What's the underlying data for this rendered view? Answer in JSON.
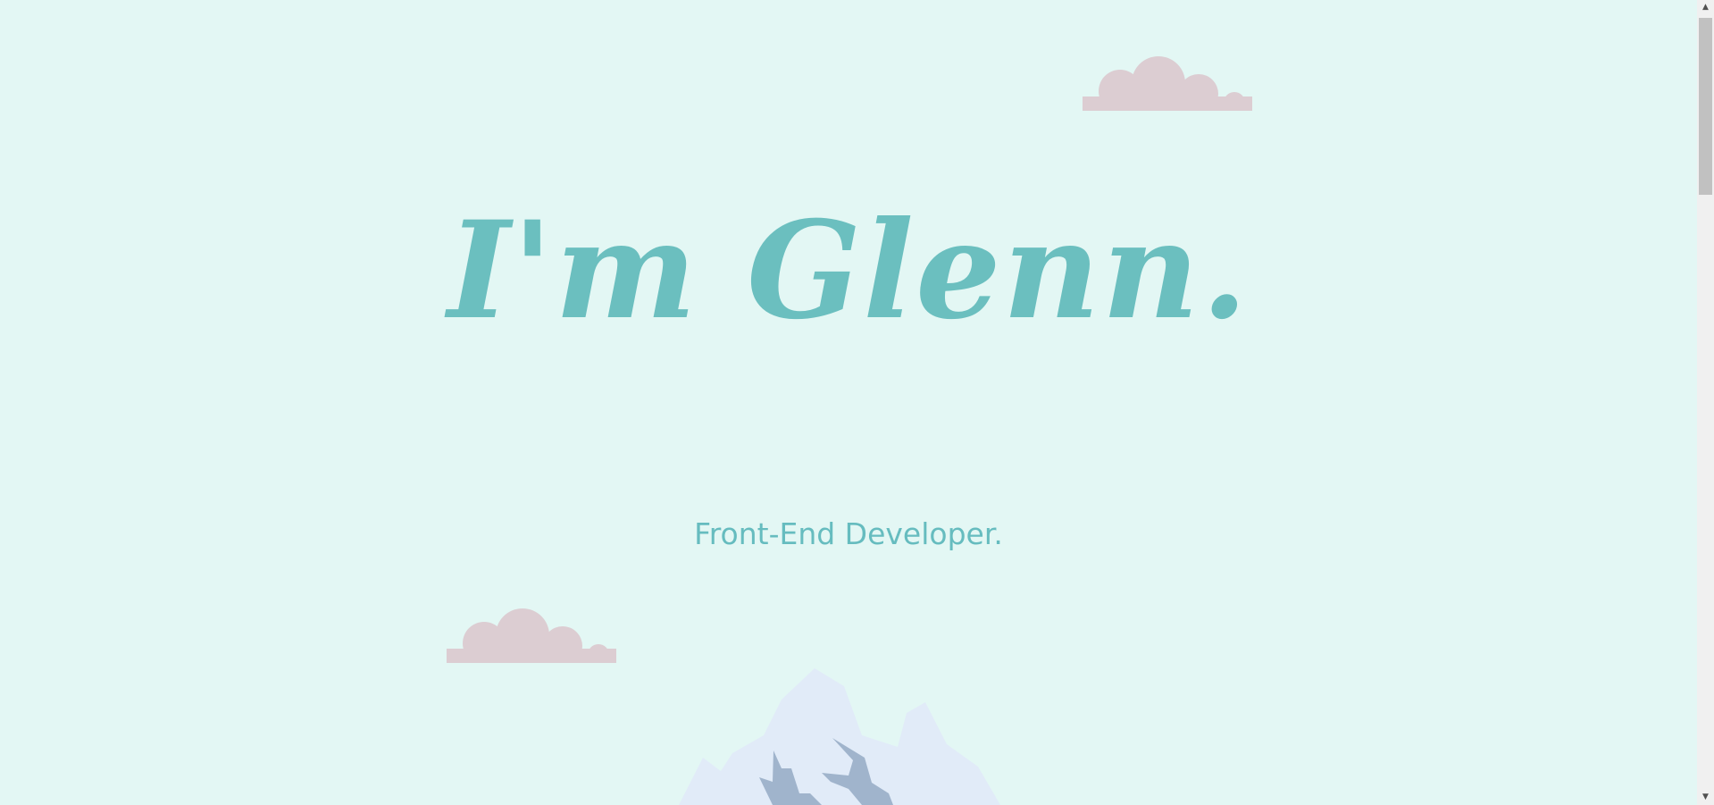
{
  "hero": {
    "title": "I'm Glenn.",
    "subtitle": "Front-End Developer."
  },
  "scrollbar": {
    "up_arrow": "▲",
    "down_arrow": "▼"
  },
  "colors": {
    "background": "#e3f7f4",
    "accent": "#6bbfbf",
    "cloud": "#dccdd2",
    "mountain_light": "#e1ebf8",
    "mountain_dark": "#a0b4cc"
  },
  "icons": {
    "clouds": "cloud-icon",
    "mountain": "mountain-icon"
  }
}
